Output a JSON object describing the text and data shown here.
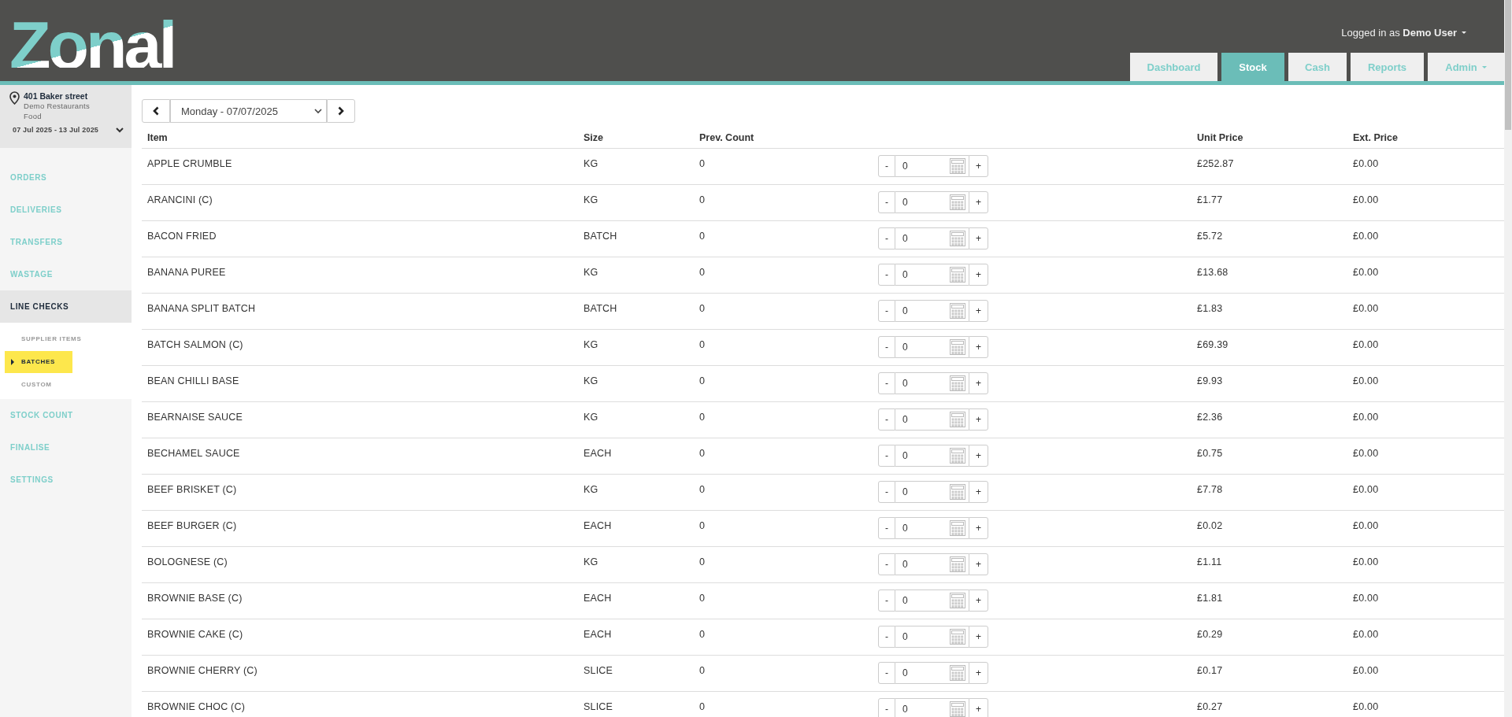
{
  "header": {
    "logo": "Zonal",
    "user_text": "Logged in as **Demo User**",
    "tabs": [
      {
        "label": "Dashboard",
        "selected": false,
        "has_menu": false
      },
      {
        "label": "Stock",
        "selected": true,
        "has_menu": false
      },
      {
        "label": "Cash",
        "selected": false,
        "has_menu": false
      },
      {
        "label": "Reports",
        "selected": false,
        "has_menu": false
      },
      {
        "label": "Admin",
        "selected": false,
        "has_menu": true
      }
    ]
  },
  "sidebar": {
    "location": {
      "name": "401 Baker street",
      "company": "Demo Restaurants",
      "category": "Food",
      "date_range": "07 Jul 2025 - 13 Jul 2025"
    },
    "nav": [
      {
        "label": "ORDERS",
        "expanded": false
      },
      {
        "label": "DELIVERIES",
        "expanded": false
      },
      {
        "label": "TRANSFERS",
        "expanded": false
      },
      {
        "label": "WASTAGE",
        "expanded": false
      },
      {
        "label": "LINE CHECKS",
        "expanded": true,
        "children": [
          {
            "label": "SUPPLIER ITEMS",
            "selected": false
          },
          {
            "label": "BATCHES",
            "selected": true
          },
          {
            "label": "CUSTOM",
            "selected": false
          }
        ]
      },
      {
        "label": "STOCK COUNT",
        "expanded": false
      },
      {
        "label": "FINALISE",
        "expanded": false
      },
      {
        "label": "SETTINGS",
        "expanded": false
      }
    ]
  },
  "date_picker": {
    "value": "Monday - 07/07/2025"
  },
  "table": {
    "columns": [
      "Item",
      "Size",
      "Prev. Count",
      "Unit Price",
      "Ext. Price"
    ],
    "rows": [
      {
        "item": "APPLE CRUMBLE",
        "size": "KG",
        "prev_count": "0",
        "minus": "-",
        "count": "0",
        "plus": "+",
        "unit_price": "£252.87",
        "ext_price": "£0.00"
      },
      {
        "item": "ARANCINI (C)",
        "size": "KG",
        "prev_count": "0",
        "minus": "-",
        "count": "0",
        "plus": "+",
        "unit_price": "£1.77",
        "ext_price": "£0.00"
      },
      {
        "item": "BACON FRIED",
        "size": "BATCH",
        "prev_count": "0",
        "minus": "-",
        "count": "0",
        "plus": "+",
        "unit_price": "£5.72",
        "ext_price": "£0.00"
      },
      {
        "item": "BANANA PUREE",
        "size": "KG",
        "prev_count": "0",
        "minus": "-",
        "count": "0",
        "plus": "+",
        "unit_price": "£13.68",
        "ext_price": "£0.00"
      },
      {
        "item": "BANANA SPLIT BATCH",
        "size": "BATCH",
        "prev_count": "0",
        "minus": "-",
        "count": "0",
        "plus": "+",
        "unit_price": "£1.83",
        "ext_price": "£0.00"
      },
      {
        "item": "BATCH SALMON (C)",
        "size": "KG",
        "prev_count": "0",
        "minus": "-",
        "count": "0",
        "plus": "+",
        "unit_price": "£69.39",
        "ext_price": "£0.00"
      },
      {
        "item": "BEAN CHILLI BASE",
        "size": "KG",
        "prev_count": "0",
        "minus": "-",
        "count": "0",
        "plus": "+",
        "unit_price": "£9.93",
        "ext_price": "£0.00"
      },
      {
        "item": "BEARNAISE SAUCE",
        "size": "KG",
        "prev_count": "0",
        "minus": "-",
        "count": "0",
        "plus": "+",
        "unit_price": "£2.36",
        "ext_price": "£0.00"
      },
      {
        "item": "BECHAMEL SAUCE",
        "size": "EACH",
        "prev_count": "0",
        "minus": "-",
        "count": "0",
        "plus": "+",
        "unit_price": "£0.75",
        "ext_price": "£0.00"
      },
      {
        "item": "BEEF BRISKET (C)",
        "size": "KG",
        "prev_count": "0",
        "minus": "-",
        "count": "0",
        "plus": "+",
        "unit_price": "£7.78",
        "ext_price": "£0.00"
      },
      {
        "item": "BEEF BURGER (C)",
        "size": "EACH",
        "prev_count": "0",
        "minus": "-",
        "count": "0",
        "plus": "+",
        "unit_price": "£0.02",
        "ext_price": "£0.00"
      },
      {
        "item": "BOLOGNESE (C)",
        "size": "KG",
        "prev_count": "0",
        "minus": "-",
        "count": "0",
        "plus": "+",
        "unit_price": "£1.11",
        "ext_price": "£0.00"
      },
      {
        "item": "BROWNIE BASE (C)",
        "size": "EACH",
        "prev_count": "0",
        "minus": "-",
        "count": "0",
        "plus": "+",
        "unit_price": "£1.81",
        "ext_price": "£0.00"
      },
      {
        "item": "BROWNIE CAKE (C)",
        "size": "EACH",
        "prev_count": "0",
        "minus": "-",
        "count": "0",
        "plus": "+",
        "unit_price": "£0.29",
        "ext_price": "£0.00"
      },
      {
        "item": "BROWNIE CHERRY (C)",
        "size": "SLICE",
        "prev_count": "0",
        "minus": "-",
        "count": "0",
        "plus": "+",
        "unit_price": "£0.17",
        "ext_price": "£0.00"
      },
      {
        "item": "BROWNIE CHOC (C)",
        "size": "SLICE",
        "prev_count": "0",
        "minus": "-",
        "count": "0",
        "plus": "+",
        "unit_price": "£0.27",
        "ext_price": "£0.00"
      }
    ]
  }
}
